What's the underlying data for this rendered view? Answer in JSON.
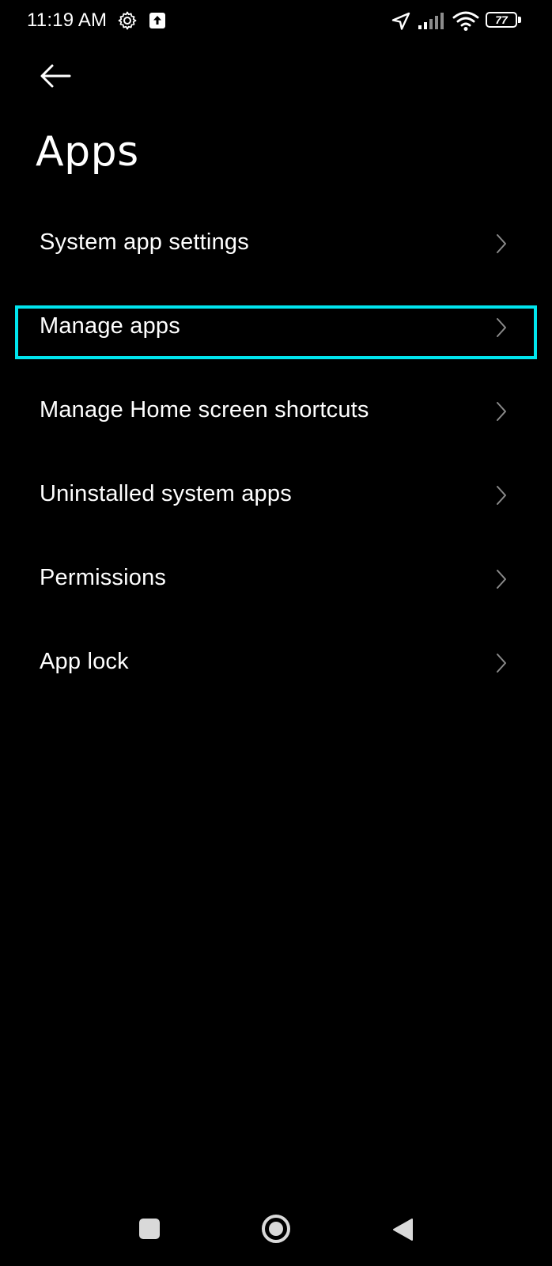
{
  "status_bar": {
    "time": "11:19 AM",
    "battery_level": "77",
    "icons": [
      "gear-icon",
      "upload-icon",
      "location-icon",
      "signal-icon",
      "wifi-icon",
      "battery-icon"
    ]
  },
  "header": {
    "back_icon": "back-arrow-icon",
    "title": "Apps"
  },
  "settings": {
    "items": [
      {
        "label": "System app settings"
      },
      {
        "label": "Manage apps",
        "highlighted": true
      },
      {
        "label": "Manage Home screen shortcuts"
      },
      {
        "label": "Uninstalled system apps"
      },
      {
        "label": "Permissions"
      },
      {
        "label": "App lock"
      }
    ]
  },
  "nav_bar": {
    "icons": [
      "recents-icon",
      "home-icon",
      "back-icon"
    ]
  },
  "colors": {
    "background": "#000000",
    "text": "#ffffff",
    "chevron": "#8a8a8a",
    "highlight": "#00e5ee"
  }
}
